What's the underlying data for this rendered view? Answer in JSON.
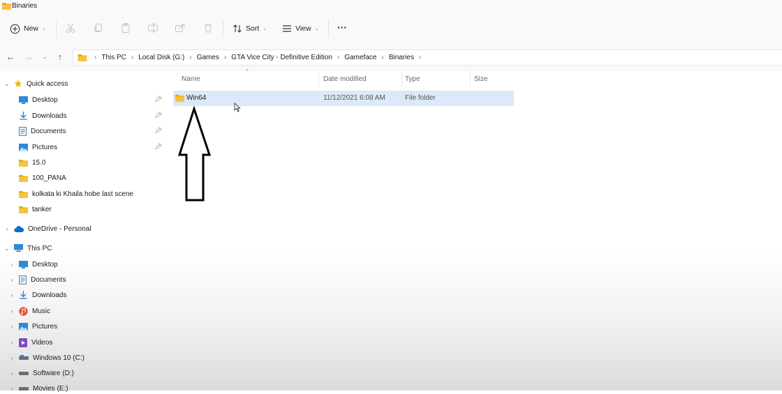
{
  "window": {
    "title": "Binaries"
  },
  "toolbar": {
    "new_label": "New",
    "sort_label": "Sort",
    "view_label": "View",
    "more_label": "···",
    "disabled_icons": [
      "cut-icon",
      "copy-icon",
      "paste-icon",
      "rename-icon",
      "share-icon",
      "delete-icon"
    ]
  },
  "address": {
    "crumbs": [
      "This PC",
      "Local Disk (G:)",
      "Games",
      "GTA Vice City - Definitive Edition",
      "Gameface",
      "Binaries"
    ]
  },
  "sidebar": {
    "quick_access": {
      "label": "Quick access",
      "items": [
        {
          "label": "Desktop",
          "icon": "desktop-icon",
          "pinned": true
        },
        {
          "label": "Downloads",
          "icon": "download-icon",
          "pinned": true
        },
        {
          "label": "Documents",
          "icon": "documents-icon",
          "pinned": true
        },
        {
          "label": "Pictures",
          "icon": "pictures-icon",
          "pinned": true
        },
        {
          "label": "15.0",
          "icon": "folder-icon",
          "pinned": false
        },
        {
          "label": "100_PANA",
          "icon": "folder-icon",
          "pinned": false
        },
        {
          "label": "kolkata ki Khaila hobe last scene",
          "icon": "folder-icon",
          "pinned": false
        },
        {
          "label": "tanker",
          "icon": "folder-icon",
          "pinned": false
        }
      ]
    },
    "onedrive": {
      "label": "OneDrive - Personal"
    },
    "this_pc": {
      "label": "This PC",
      "items": [
        {
          "label": "Desktop",
          "icon": "desktop-icon"
        },
        {
          "label": "Documents",
          "icon": "documents-icon"
        },
        {
          "label": "Downloads",
          "icon": "download-icon"
        },
        {
          "label": "Music",
          "icon": "music-icon"
        },
        {
          "label": "Pictures",
          "icon": "pictures-icon"
        },
        {
          "label": "Videos",
          "icon": "videos-icon"
        },
        {
          "label": "Windows 10 (C:)",
          "icon": "drive-icon"
        },
        {
          "label": "Software (D:)",
          "icon": "drive-icon"
        },
        {
          "label": "Movies (E:)",
          "icon": "drive-icon"
        }
      ]
    }
  },
  "filelist": {
    "columns": [
      "Name",
      "Date modified",
      "Type",
      "Size"
    ],
    "rows": [
      {
        "name": "Win64",
        "date": "11/12/2021 6:08 AM",
        "type": "File folder",
        "size": ""
      }
    ]
  },
  "colors": {
    "folder": "#f5c342",
    "selection": "#dbe9f8",
    "accent": "#0067c0"
  }
}
